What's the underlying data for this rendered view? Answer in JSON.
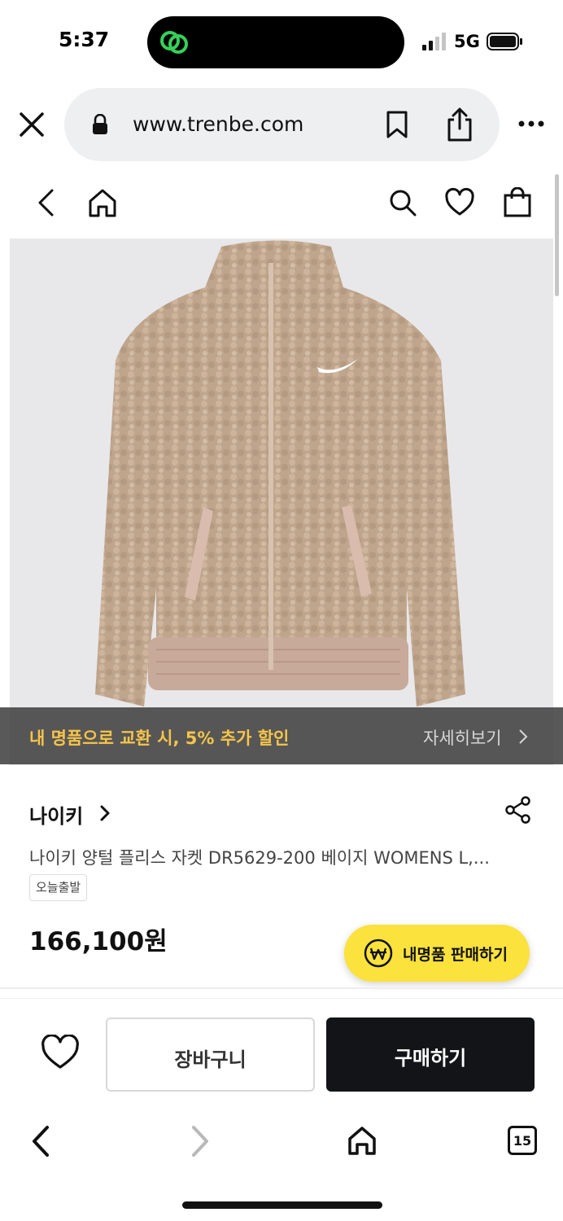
{
  "status_bar": {
    "time": "5:37",
    "network": "5G"
  },
  "browser": {
    "url": "www.trenbe.com",
    "open_tabs": "15"
  },
  "banner": {
    "promo_text": "내 명품으로 교환 시, 5% 추가 할인",
    "detail_link": "자세히보기"
  },
  "product": {
    "brand": "나이키",
    "name": "나이키 양털 플리스 자켓 DR5629-200 베이지 WOMENS L,...",
    "tag": "오늘출발",
    "price": "166,100원"
  },
  "sell_button": {
    "label": "내명품 판매하기"
  },
  "actions": {
    "cart_label": "장바구니",
    "buy_label": "구매하기"
  },
  "colors": {
    "accent_yellow": "#fbe23c",
    "banner_text": "#f5c44a",
    "buy_button": "#121417"
  }
}
